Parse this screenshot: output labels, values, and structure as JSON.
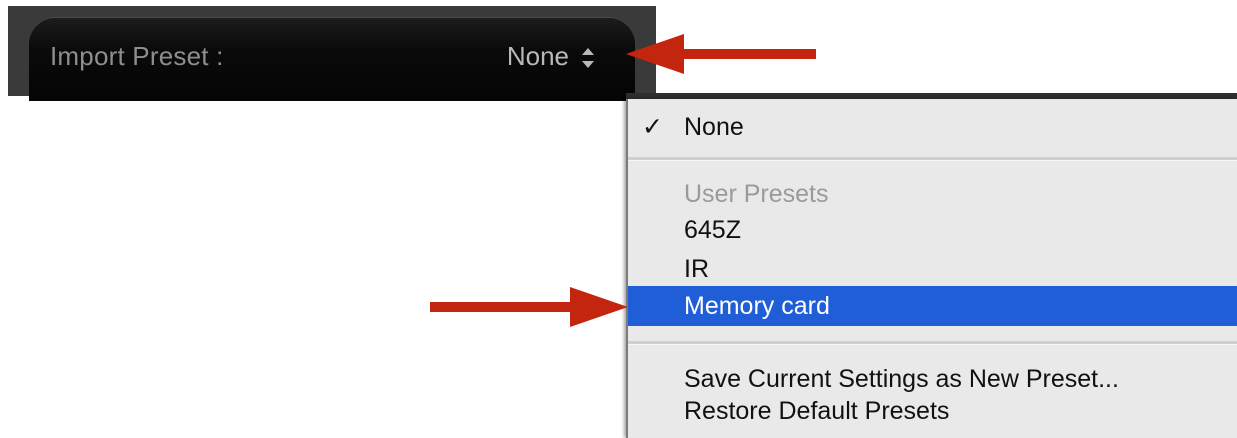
{
  "import_preset": {
    "label": "Import Preset :",
    "value": "None"
  },
  "menu": {
    "checked_item": "None",
    "check_mark": "✓",
    "section_header": "User Presets",
    "presets": [
      "645Z",
      "IR",
      "Memory card"
    ],
    "selected_preset": "Memory card",
    "actions": [
      "Save Current Settings as New Preset...",
      "Restore Default Presets"
    ]
  },
  "colors": {
    "arrow": "#c4250f",
    "selection": "#1f5ed6",
    "bar": "#0a0a0a"
  },
  "icons": {
    "stepper": "up-down-chevron-icon",
    "arrow": "right-pointing-arrow-icon"
  }
}
